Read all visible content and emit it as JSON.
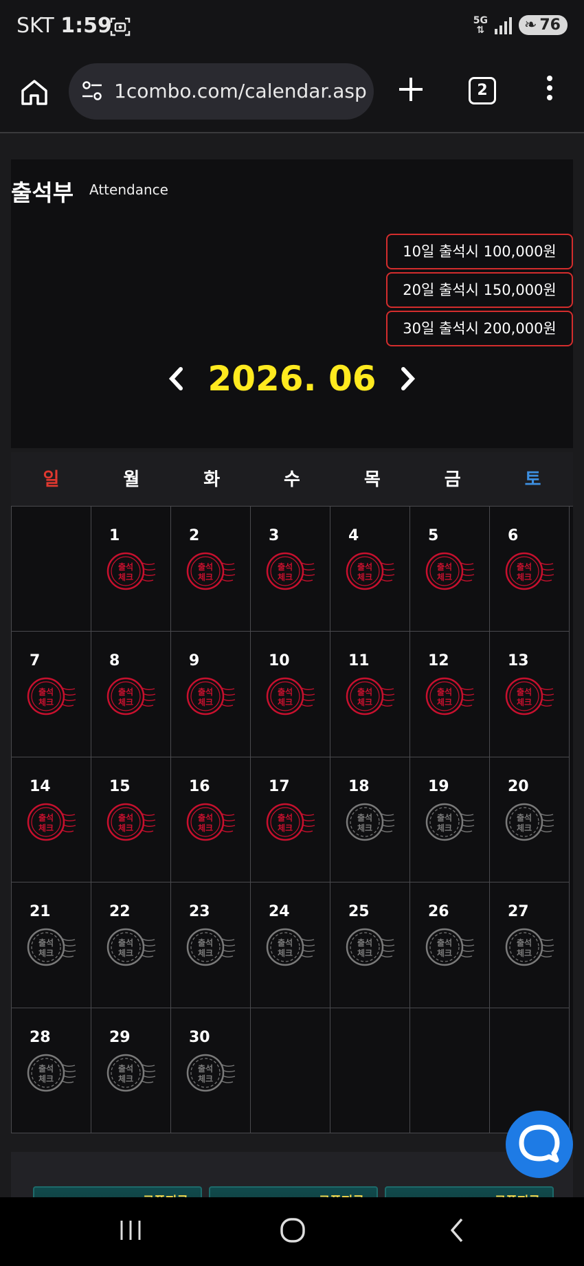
{
  "status_bar": {
    "carrier": "SKT",
    "time": "1:59",
    "network": "5G",
    "battery": "76"
  },
  "browser": {
    "url": "1combo.com/calendar.asp",
    "tab_count": "2"
  },
  "page": {
    "title": "출석부",
    "subtitle": "Attendance"
  },
  "rewards": [
    "10일 출석시 100,000원",
    "20일 출석시 150,000원",
    "30일 출석시 200,000원"
  ],
  "month": {
    "label": "2026. 06"
  },
  "weekdays": [
    "일",
    "월",
    "화",
    "수",
    "목",
    "금",
    "토"
  ],
  "colors": {
    "sunday": "#e0382f",
    "saturday": "#3d8fe0",
    "weekday": "#ffffff",
    "month": "#ffea1f",
    "checked_stamp": "#c8102e",
    "unchecked_stamp": "#7a7a7a",
    "reward_border": "#d42d2d",
    "chat_button": "#1e7be5"
  },
  "stamp_text": [
    "출석",
    "체크"
  ],
  "calendar": {
    "leading_blank": 1,
    "days": [
      {
        "n": "1",
        "checked": true
      },
      {
        "n": "2",
        "checked": true
      },
      {
        "n": "3",
        "checked": true
      },
      {
        "n": "4",
        "checked": true
      },
      {
        "n": "5",
        "checked": true
      },
      {
        "n": "6",
        "checked": true
      },
      {
        "n": "7",
        "checked": true
      },
      {
        "n": "8",
        "checked": true
      },
      {
        "n": "9",
        "checked": true
      },
      {
        "n": "10",
        "checked": true
      },
      {
        "n": "11",
        "checked": true
      },
      {
        "n": "12",
        "checked": true
      },
      {
        "n": "13",
        "checked": true
      },
      {
        "n": "14",
        "checked": true
      },
      {
        "n": "15",
        "checked": true
      },
      {
        "n": "16",
        "checked": true
      },
      {
        "n": "17",
        "checked": true
      },
      {
        "n": "18",
        "checked": false
      },
      {
        "n": "19",
        "checked": false
      },
      {
        "n": "20",
        "checked": false
      },
      {
        "n": "21",
        "checked": false
      },
      {
        "n": "22",
        "checked": false
      },
      {
        "n": "23",
        "checked": false
      },
      {
        "n": "24",
        "checked": false
      },
      {
        "n": "25",
        "checked": false
      },
      {
        "n": "26",
        "checked": false
      },
      {
        "n": "27",
        "checked": false
      },
      {
        "n": "28",
        "checked": false
      },
      {
        "n": "29",
        "checked": false
      },
      {
        "n": "30",
        "checked": false
      }
    ]
  },
  "banners": [
    {
      "label": "쿠폰지급"
    },
    {
      "label": "쿠폰지급"
    },
    {
      "label": "쿠폰지급"
    }
  ],
  "icons": [
    "screenshot-icon",
    "signal-icon",
    "battery-icon",
    "home-icon",
    "site-settings-icon",
    "new-tab-icon",
    "tabs-icon",
    "menu-icon",
    "chevron-left-icon",
    "chevron-right-icon",
    "chat-icon",
    "recent-apps-icon",
    "home-nav-icon",
    "back-icon"
  ]
}
